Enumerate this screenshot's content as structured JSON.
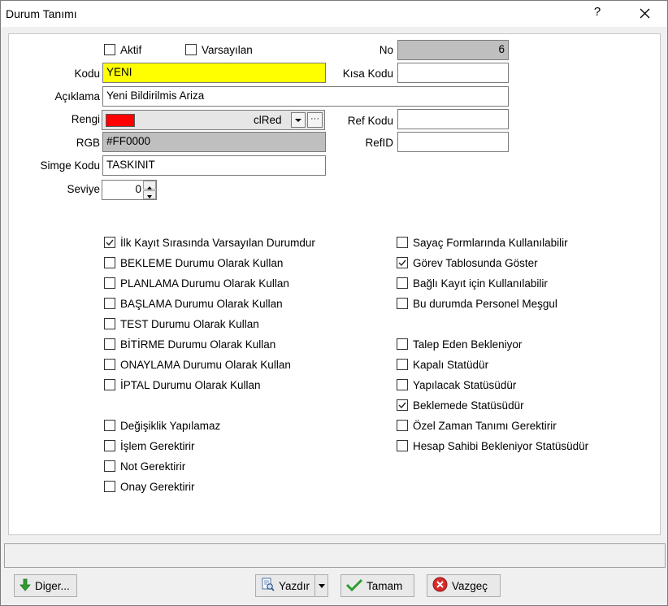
{
  "window": {
    "title": "Durum Tanımı",
    "help": "?"
  },
  "top": {
    "aktif": {
      "label": "Aktif",
      "checked": false
    },
    "varsayilan": {
      "label": "Varsayılan",
      "checked": false
    },
    "no_label": "No",
    "no_value": "6",
    "kodu_label": "Kodu",
    "kodu_value": "YENI",
    "kisa_kodu_label": "Kısa Kodu",
    "kisa_kodu_value": "",
    "aciklama_label": "Açıklama",
    "aciklama_value": "Yeni Bildirilmis Ariza",
    "rengi_label": "Rengi",
    "rengi_value": "clRed",
    "rengi_color": "#ff0000",
    "dots": "···",
    "ref_kodu_label": "Ref Kodu",
    "ref_kodu_value": "",
    "rgb_label": "RGB",
    "rgb_value": "#FF0000",
    "refid_label": "RefID",
    "refid_value": "",
    "simge_label": "Simge Kodu",
    "simge_value": "TASKINIT",
    "seviye_label": "Seviye",
    "seviye_value": "0"
  },
  "left_checks": [
    {
      "label": "İlk Kayıt Sırasında Varsayılan Durumdur",
      "checked": true
    },
    {
      "label": "BEKLEME Durumu Olarak Kullan",
      "checked": false
    },
    {
      "label": "PLANLAMA Durumu Olarak Kullan",
      "checked": false
    },
    {
      "label": "BAŞLAMA Durumu Olarak Kullan",
      "checked": false
    },
    {
      "label": "TEST Durumu Olarak Kullan",
      "checked": false
    },
    {
      "label": "BİTİRME Durumu Olarak Kullan",
      "checked": false
    },
    {
      "label": "ONAYLAMA Durumu Olarak Kullan",
      "checked": false
    },
    {
      "label": "İPTAL Durumu Olarak Kullan",
      "checked": false
    },
    {
      "label": "Değişiklik Yapılamaz",
      "checked": false
    },
    {
      "label": "İşlem Gerektirir",
      "checked": false
    },
    {
      "label": "Not Gerektirir",
      "checked": false
    },
    {
      "label": "Onay Gerektirir",
      "checked": false
    }
  ],
  "right_checks": [
    {
      "label": "Sayaç Formlarında Kullanılabilir",
      "checked": false
    },
    {
      "label": "Görev Tablosunda Göster",
      "checked": true
    },
    {
      "label": "Bağlı Kayıt için Kullanılabilir",
      "checked": false
    },
    {
      "label": "Bu durumda Personel Meşgul",
      "checked": false
    },
    {
      "label": "Talep Eden Bekleniyor",
      "checked": false
    },
    {
      "label": "Kapalı Statüdür",
      "checked": false
    },
    {
      "label": "Yapılacak Statüsüdür",
      "checked": false
    },
    {
      "label": "Beklemede Statüsüdür",
      "checked": true
    },
    {
      "label": "Özel Zaman Tanımı Gerektirir",
      "checked": false
    },
    {
      "label": "Hesap Sahibi Bekleniyor Statüsüdür",
      "checked": false
    }
  ],
  "buttons": {
    "diger": "Diger...",
    "yazdir": "Yazdır",
    "tamam": "Tamam",
    "vazgec": "Vazgeç"
  },
  "colors": {
    "field_yellow": "#ffff00",
    "field_grey": "#bfbfbf",
    "accent_green": "#2e9e2e",
    "accent_red": "#d92b2b"
  },
  "icons": {
    "close": "close-icon",
    "diger": "arrow-down-green-icon",
    "yazdir": "print-preview-icon",
    "tamam": "checkmark-green-icon",
    "vazgec": "cancel-red-icon"
  }
}
